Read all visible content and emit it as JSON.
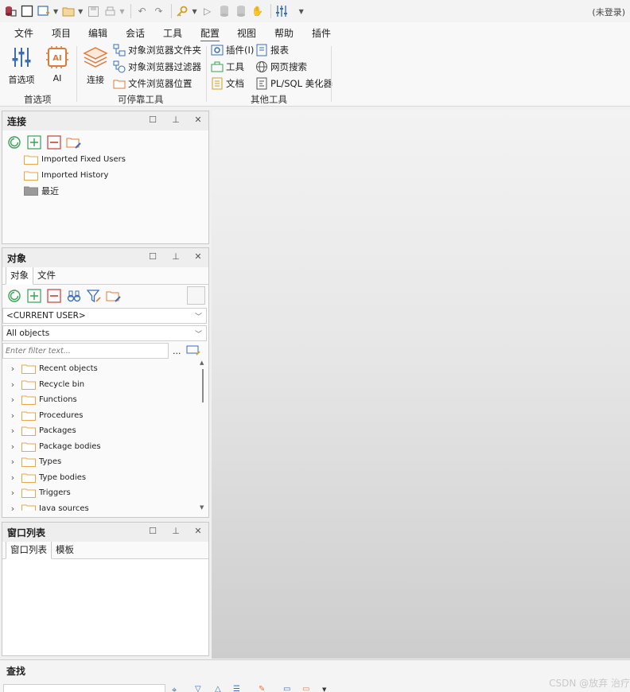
{
  "titlebar": {
    "status": "(未登录)"
  },
  "menu": {
    "items": [
      "文件",
      "项目",
      "编辑",
      "会话",
      "工具",
      "配置",
      "视图",
      "帮助",
      "插件"
    ],
    "active": "配置"
  },
  "ribbon": {
    "prefs_label": "首选项",
    "ai_label": "AI",
    "connect_label": "连接",
    "ob_folder_label": "对象浏览器文件夹",
    "ob_filter_label": "对象浏览器过滤器",
    "fb_location_label": "文件浏览器位置",
    "plugins_label": "插件(I)",
    "tools_label": "工具",
    "docs_label": "文档",
    "reports_label": "报表",
    "websearch_label": "网页搜索",
    "beautifier_label": "PL/SQL 美化器",
    "group_prefs": "首选项",
    "group_dockable": "可停靠工具",
    "group_other": "其他工具"
  },
  "connections_panel": {
    "title": "连接",
    "items": [
      "Imported Fixed Users",
      "Imported History",
      "最近"
    ]
  },
  "objects_panel": {
    "title": "对象",
    "tab_objects": "对象",
    "tab_files": "文件",
    "user_select": "<CURRENT USER>",
    "object_filter": "All objects",
    "filter_placeholder": "Enter filter text...",
    "filter_more": "...",
    "items": [
      "Recent objects",
      "Recycle bin",
      "Functions",
      "Procedures",
      "Packages",
      "Package bodies",
      "Types",
      "Type bodies",
      "Triggers",
      "Java sources"
    ]
  },
  "windows_panel": {
    "title": "窗口列表",
    "tab_windows": "窗口列表",
    "tab_templates": "模板"
  },
  "find_panel": {
    "title": "查找"
  },
  "watermark": "CSDN @放弃          治疗"
}
